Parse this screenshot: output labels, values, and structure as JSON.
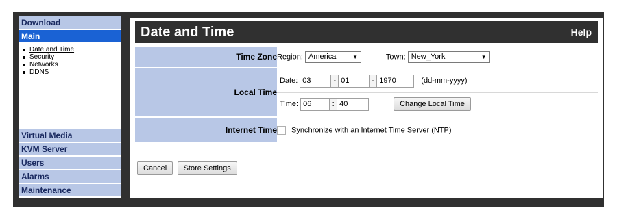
{
  "sidebar": {
    "top_items": [
      {
        "label": "Download"
      },
      {
        "label": "Main"
      }
    ],
    "sub_items": [
      {
        "label": "Date and Time"
      },
      {
        "label": "Security"
      },
      {
        "label": "Networks"
      },
      {
        "label": "DDNS"
      }
    ],
    "bottom_items": [
      {
        "label": "Virtual Media"
      },
      {
        "label": "KVM Server"
      },
      {
        "label": "Users"
      },
      {
        "label": "Alarms"
      },
      {
        "label": "Maintenance"
      }
    ]
  },
  "header": {
    "title": "Date and Time",
    "help": "Help"
  },
  "timezone": {
    "label": "Time Zone",
    "region_label": "Region:",
    "region_value": "America",
    "town_label": "Town:",
    "town_value": "New_York"
  },
  "localtime": {
    "label": "Local Time",
    "date_label": "Date:",
    "day": "03",
    "date_sep": "-",
    "month": "01",
    "year": "1970",
    "date_format": "(dd-mm-yyyy)",
    "time_label": "Time:",
    "hour": "06",
    "time_sep": ":",
    "minute": "40",
    "change_button": "Change Local Time"
  },
  "internettime": {
    "label": "Internet Time",
    "ntp_label": "Synchronize with an Internet Time Server (NTP)",
    "ntp_checked": false
  },
  "actions": {
    "cancel": "Cancel",
    "store": "Store Settings"
  },
  "colors": {
    "sidebar_item_bg": "#b8c7e6",
    "sidebar_active_bg": "#1a62d4",
    "header_bg": "#303030",
    "frame_bg": "#303030"
  }
}
